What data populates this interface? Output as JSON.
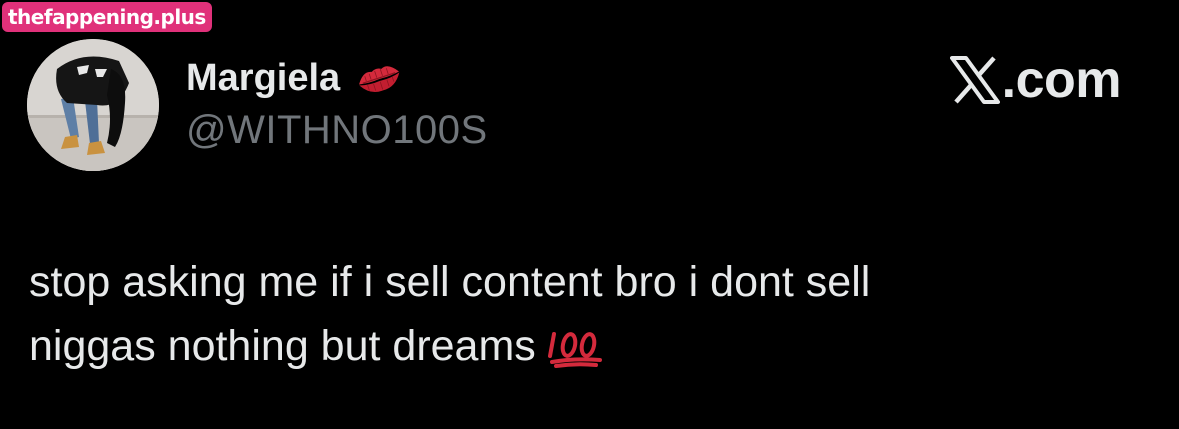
{
  "watermark": {
    "text": "thefappening.plus"
  },
  "author": {
    "display_name": "Margiela",
    "handle": "@WITHNO100S",
    "name_emoji": "kiss-mark-icon"
  },
  "brand": {
    "logo": "x-logo-icon",
    "text": ".com"
  },
  "tweet": {
    "lines": [
      "stop asking me if i sell content bro i dont sell",
      "niggas nothing but dreams"
    ],
    "trailing_emoji": "hundred-points-icon"
  },
  "colors": {
    "background": "#000000",
    "primary_text": "#e7e9ea",
    "secondary_text": "#71767b",
    "watermark_bg": "#e0317a",
    "emoji_red": "#d42a3c"
  }
}
